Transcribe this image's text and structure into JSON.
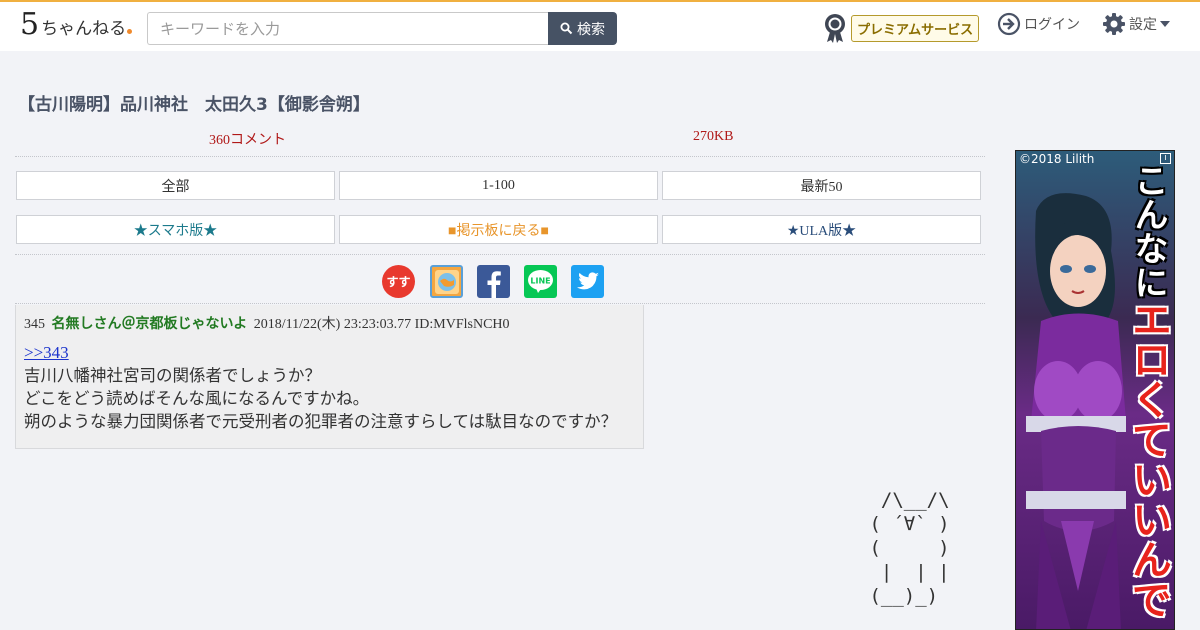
{
  "header": {
    "logo_number": "5",
    "logo_text": "ちゃんねる",
    "search_placeholder": "キーワードを入力",
    "search_button": "検索",
    "premium_label": "プレミアムサービス",
    "login_label": "ログイン",
    "settings_label": "設定"
  },
  "thread": {
    "title": "【古川陽明】品川神社　太田久3【御影舎朔】",
    "comments": "360コメント",
    "size": "270KB"
  },
  "nav": {
    "all": "全部",
    "range": "1-100",
    "latest": "最新50",
    "smartphone": "★スマホ版★",
    "back_to_board": "■掲示板に戻る■",
    "ula": "★ULA版★"
  },
  "share": {
    "icons": [
      "sumaho-icon",
      "matome-icon",
      "facebook-icon",
      "line-icon",
      "twitter-icon"
    ],
    "line_text": "LINE",
    "sumaho_text": "すす"
  },
  "post": {
    "number": "345",
    "name": "名無しさん＠京都板じゃないよ",
    "date": "2018/11/22(木) 23:23:03.77",
    "id": "ID:MVFlsNCH0",
    "anchor": ">>343",
    "lines": [
      "吉川八幡神社宮司の関係者でしょうか？",
      "どこをどう読めばそんな風になるんですかね。",
      "朔のような暴力団関係者で元受刑者の犯罪者の注意すらしては駄目なのですか？"
    ]
  },
  "ascii_art": "  /\\__/\\\n ( ´∀` )\n (     )\n  |  | |\n (__)_)",
  "ad": {
    "copyright": "©2018 Lilith",
    "info": "i",
    "text_1": "こんなに",
    "text_2": "エロくて",
    "text_3": "いいんで"
  },
  "colors": {
    "header_accent": "#f0b040",
    "search_button": "#465264",
    "meta_red": "#b01818",
    "poster_green": "#227a22",
    "link_blue": "#1b33cc"
  }
}
